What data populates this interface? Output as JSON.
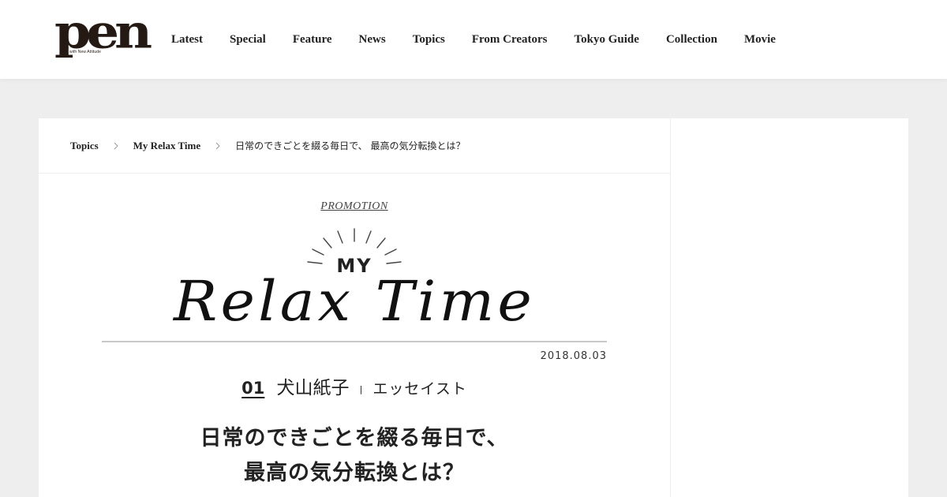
{
  "site": {
    "logo_text": "pen",
    "logo_tagline": "with New Attitude"
  },
  "nav": {
    "items": [
      "Latest",
      "Special",
      "Feature",
      "News",
      "Topics",
      "From Creators",
      "Tokyo Guide",
      "Collection",
      "Movie"
    ]
  },
  "breadcrumb": {
    "items": [
      "Topics",
      "My Relax Time",
      "日常のできごとを綴る毎日で、 最高の気分転換とは？"
    ]
  },
  "article": {
    "label": "PROMOTION",
    "series_logo": {
      "top": "MY",
      "main": "Relax Time"
    },
    "date": "2018.08.03",
    "number": "01",
    "author": "犬山紙子",
    "separator": "|",
    "role": "エッセイスト",
    "title_line1": "日常のできごとを綴る毎日で、",
    "title_line2": "最高の気分転換とは？"
  }
}
